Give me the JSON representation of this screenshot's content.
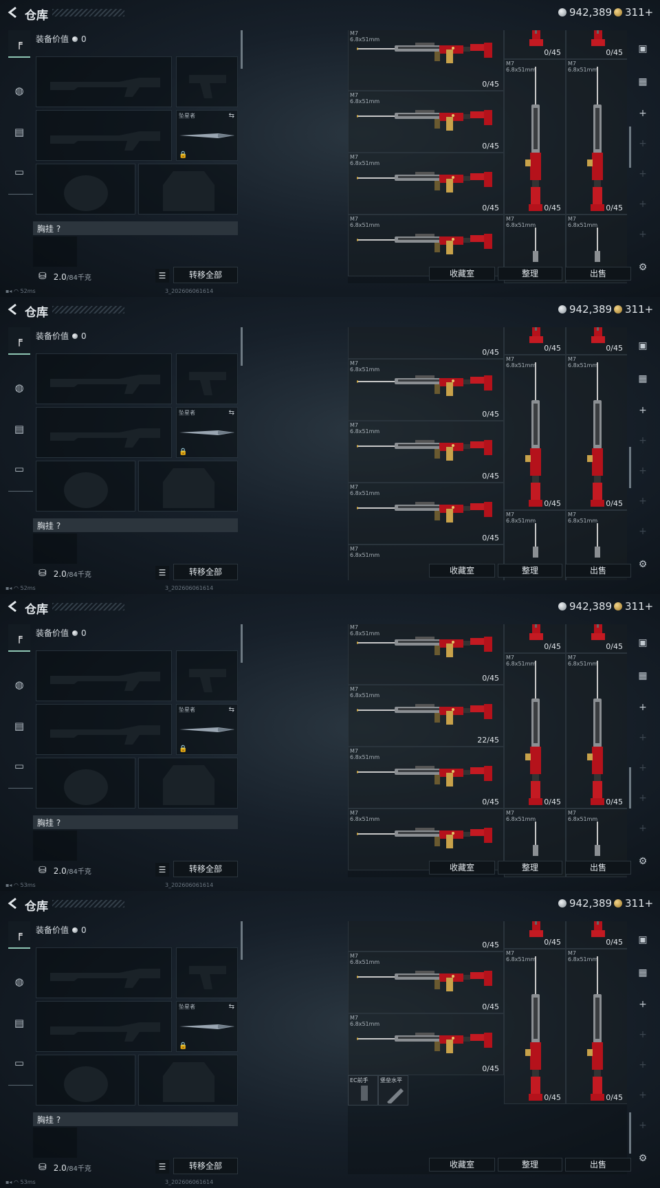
{
  "header": {
    "title": "仓库",
    "silver": "942,389",
    "gold": "311+"
  },
  "loadout": {
    "value_label": "装备价值",
    "value": "0",
    "melee_name": "坠星者",
    "chest_label": "胸挂",
    "chest_hint": "?",
    "weight_value": "2.0",
    "weight_max": "/84千克",
    "transfer_label": "转移全部"
  },
  "grid": {
    "item_name": "M7",
    "item_caliber": "6.8x51mm",
    "count_zero": "0/45",
    "count_partial": "22/45",
    "attachments": [
      "EC前手",
      "堡垒水平"
    ]
  },
  "buttons": {
    "collection": "收藏室",
    "sort": "整理",
    "sell": "出售"
  },
  "status": {
    "ping_1": "52ms",
    "ping_2": "53ms",
    "build": "3_202606061614"
  },
  "colors": {
    "rifle_red": "#b5121b",
    "accent_teal": "#8fc7b5"
  },
  "frames": [
    {
      "id": "f1",
      "scroll_ratio": 0.12
    },
    {
      "id": "f2",
      "scroll_ratio": 0.52
    },
    {
      "id": "f3",
      "scroll_ratio": 0.7
    },
    {
      "id": "f4",
      "scroll_ratio": 0.95
    }
  ]
}
